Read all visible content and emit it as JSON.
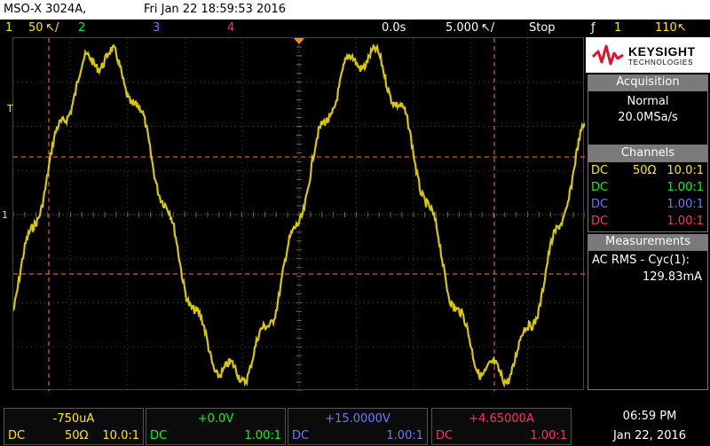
{
  "header": {
    "model": "MSO-X 3024A,",
    "datetime": "Fri Jan 22 18:59:53 2016"
  },
  "status": {
    "ch1_num": "1",
    "ch1_scale": "50 ↖/",
    "ch2_num": "2",
    "ch3_num": "3",
    "ch4_num": "4",
    "delay": "0.0s",
    "timebase": "5.000 ↖/",
    "run_state": "Stop",
    "trigger_symbol": "ƒ",
    "trigger_source": "1",
    "trigger_level": "110↖"
  },
  "markers": {
    "trigger_label": "T",
    "ground_label": "1"
  },
  "logo": {
    "brand": "KEYSIGHT",
    "sub": "TECHNOLOGIES"
  },
  "acquisition": {
    "title": "Acquisition",
    "mode": "Normal",
    "rate": "20.0MSa/s"
  },
  "channels": {
    "title": "Channels",
    "rows": [
      {
        "coupling": "DC",
        "imp": "50Ω",
        "probe": "10.0:1",
        "color": "#ffea00"
      },
      {
        "coupling": "DC",
        "imp": "",
        "probe": "1.00:1",
        "color": "#00ff00"
      },
      {
        "coupling": "DC",
        "imp": "",
        "probe": "1.00:1",
        "color": "#6f7bff"
      },
      {
        "coupling": "DC",
        "imp": "",
        "probe": "1.00:1",
        "color": "#ff2f6a"
      }
    ]
  },
  "measurements": {
    "title": "Measurements",
    "label": "AC RMS - Cyc(1):",
    "value": "129.83mA"
  },
  "bottom_channels": [
    {
      "offset": "-750uA",
      "coupling": "DC",
      "imp": "50Ω",
      "probe": "10.0:1",
      "color": "#ffea00"
    },
    {
      "offset": "+0.0V",
      "coupling": "DC",
      "imp": "",
      "probe": "1.00:1",
      "color": "#00ff00"
    },
    {
      "offset": "+15.0000V",
      "coupling": "DC",
      "imp": "",
      "probe": "1.00:1",
      "color": "#6f7bff"
    },
    {
      "offset": "+4.65000A",
      "coupling": "DC",
      "imp": "",
      "probe": "1.00:1",
      "color": "#ff2f6a"
    }
  ],
  "clock": {
    "time": "06:59 PM",
    "date": "Jan 22, 2016"
  },
  "colors": {
    "ch1": "#ffea00",
    "ch2": "#00ff00",
    "ch3": "#6f7bff",
    "ch4": "#ff2f6a",
    "cursor": "#ff7a3a",
    "trigger_marker": "#ff8a00"
  }
}
